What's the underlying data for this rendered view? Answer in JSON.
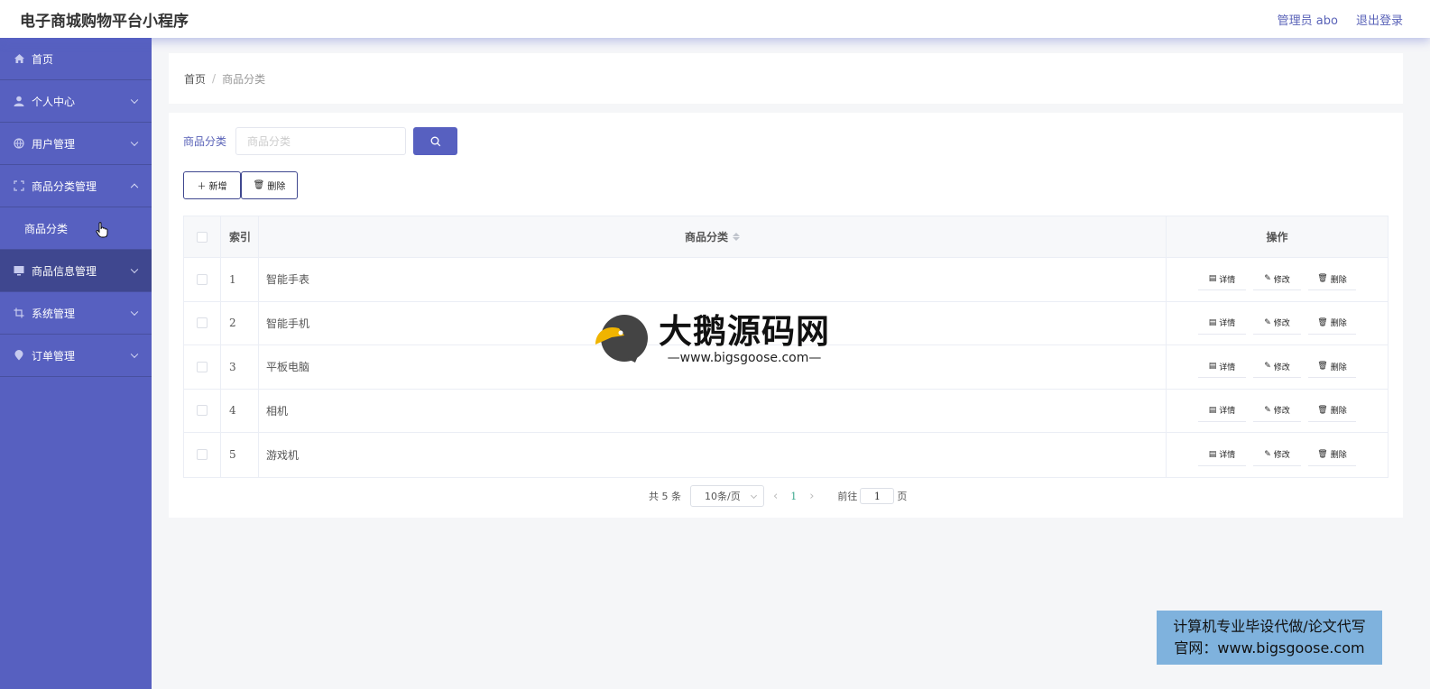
{
  "header": {
    "title": "电子商城购物平台小程序",
    "user": "管理员 abo",
    "logout": "退出登录"
  },
  "sidebar": {
    "items": [
      {
        "label": "首页",
        "icon": "home-icon"
      },
      {
        "label": "个人中心",
        "icon": "user-icon"
      },
      {
        "label": "用户管理",
        "icon": "globe-icon"
      },
      {
        "label": "商品分类管理",
        "icon": "fullscreen-icon",
        "expanded": true,
        "children": [
          "商品分类"
        ]
      },
      {
        "label": "商品信息管理",
        "icon": "monitor-icon",
        "hovered": true
      },
      {
        "label": "系统管理",
        "icon": "crop-icon"
      },
      {
        "label": "订单管理",
        "icon": "pin-icon"
      }
    ]
  },
  "breadcrumb": {
    "home": "首页",
    "sep": "/",
    "current": "商品分类"
  },
  "search": {
    "label": "商品分类",
    "placeholder": "商品分类"
  },
  "buttons": {
    "add": "新增",
    "delete": "删除"
  },
  "table": {
    "headers": {
      "index": "索引",
      "name": "商品分类",
      "ops": "操作"
    },
    "rows": [
      {
        "index": "1",
        "name": "智能手表"
      },
      {
        "index": "2",
        "name": "智能手机"
      },
      {
        "index": "3",
        "name": "平板电脑"
      },
      {
        "index": "4",
        "name": "相机"
      },
      {
        "index": "5",
        "name": "游戏机"
      }
    ],
    "row_actions": {
      "detail": "详情",
      "edit": "修改",
      "delete": "删除"
    }
  },
  "pagination": {
    "total": "共 5 条",
    "page_size": "10条/页",
    "current_page": "1",
    "goto_label": "前往",
    "goto_value": "1",
    "page_suffix": "页"
  },
  "watermark": {
    "title": "大鹅源码网",
    "url": "—www.bigsgoose.com—"
  },
  "ad": {
    "line1": "计算机专业毕设代做/论文代写",
    "line2": "官网：www.bigsgoose.com"
  },
  "colors": {
    "sidebar": "#5760c0",
    "accent": "#5760c0",
    "active_nav": "#3f478f",
    "page_number": "#3aa88d"
  }
}
